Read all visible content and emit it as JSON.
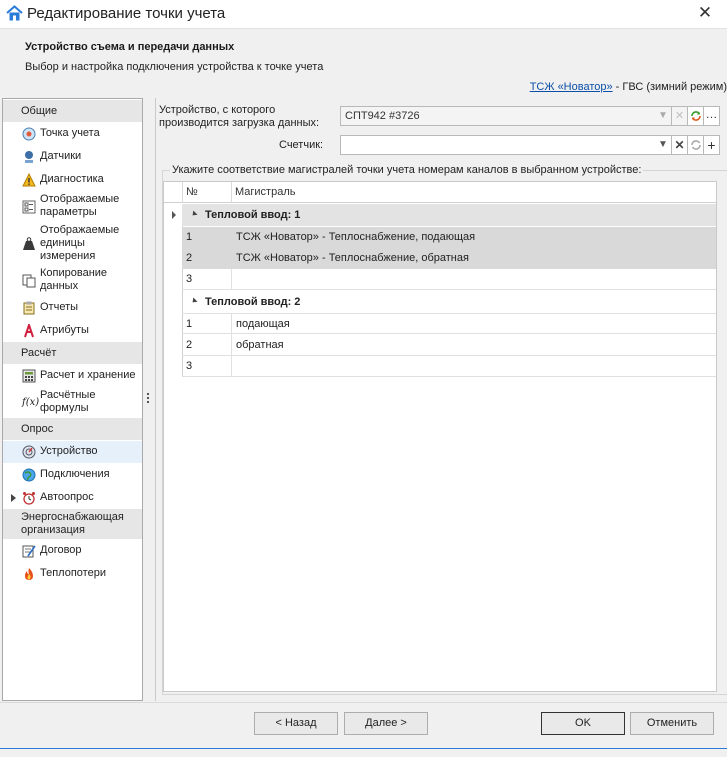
{
  "window": {
    "title": "Редактирование точки учета"
  },
  "header": {
    "title": "Устройство съема и передачи данных",
    "subtitle": "Выбор и настройка подключения устройства к точке учета",
    "link": "ТСЖ «Новатор»",
    "suffix": " - ГВС (зимний режим)"
  },
  "sidebar": {
    "groups": [
      {
        "label": "Общие"
      },
      {
        "label": "Расчёт"
      },
      {
        "label": "Опрос"
      },
      {
        "label": "Энергоснабжающая организация"
      }
    ],
    "items": [
      {
        "label": "Точка учета",
        "icon": "meter-point-icon"
      },
      {
        "label": "Датчики",
        "icon": "sensor-icon"
      },
      {
        "label": "Диагностика",
        "icon": "warning-icon"
      },
      {
        "label": "Отображаемые параметры",
        "icon": "parameters-icon"
      },
      {
        "label": "Отображаемые единицы измерения",
        "icon": "weight-icon"
      },
      {
        "label": "Копирование данных",
        "icon": "copy-icon"
      },
      {
        "label": "Отчеты",
        "icon": "report-icon"
      },
      {
        "label": "Атрибуты",
        "icon": "attribute-icon"
      },
      {
        "label": "Расчет и хранение",
        "icon": "calculator-icon"
      },
      {
        "label": "Расчётные формулы",
        "icon": "formula-icon"
      },
      {
        "label": "Устройство",
        "icon": "device-icon"
      },
      {
        "label": "Подключения",
        "icon": "globe-icon"
      },
      {
        "label": "Автоопрос",
        "icon": "alarm-clock-icon"
      },
      {
        "label": "Договор",
        "icon": "contract-icon"
      },
      {
        "label": "Теплопотери",
        "icon": "flame-icon"
      }
    ]
  },
  "form": {
    "device_label": "Устройство, с которого производится загрузка данных:",
    "device_value": "СПТ942 #3726",
    "counter_label": "Счетчик:",
    "counter_value": "",
    "mapping_label": "Укажите соответствие магистралей точки учета номерам каналов в выбранном устройстве:"
  },
  "grid": {
    "col_num": "№",
    "col_main": "Магистраль",
    "groups": [
      {
        "title": "Тепловой ввод: 1",
        "rows": [
          {
            "num": "1",
            "main": "ТСЖ «Новатор» - Теплоснабжение, подающая"
          },
          {
            "num": "2",
            "main": "ТСЖ «Новатор» - Теплоснабжение, обратная"
          },
          {
            "num": "3",
            "main": ""
          }
        ]
      },
      {
        "title": "Тепловой ввод: 2",
        "rows": [
          {
            "num": "1",
            "main": "подающая"
          },
          {
            "num": "2",
            "main": "обратная"
          },
          {
            "num": "3",
            "main": ""
          }
        ]
      }
    ]
  },
  "footer": {
    "back": "< Назад",
    "next": "Далее >",
    "ok": "OK",
    "cancel": "Отменить"
  },
  "colors": {
    "accent": "#2b7bd8",
    "link": "#0b4fa8",
    "selected_row": "#d9d9d9",
    "active_item": "#e5f0fa"
  }
}
